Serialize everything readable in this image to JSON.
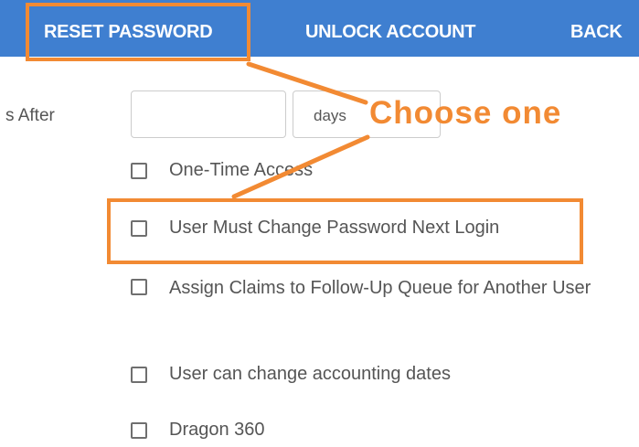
{
  "toolbar": {
    "reset_password": "RESET PASSWORD",
    "unlock_account": "UNLOCK ACCOUNT",
    "back": "BACK"
  },
  "expiry": {
    "label": "s After",
    "number_value": "",
    "unit_selected": "days"
  },
  "options": [
    {
      "label": "One-Time Access",
      "checked": false
    },
    {
      "label": "User Must Change Password Next Login",
      "checked": false
    },
    {
      "label": "Assign Claims to Follow-Up Queue for Another User",
      "checked": false
    },
    {
      "label": "User can change accounting dates",
      "checked": false
    },
    {
      "label": "Dragon 360",
      "checked": false
    }
  ],
  "annotation": {
    "text": "Choose one",
    "color": "#f28a33"
  },
  "colors": {
    "toolbar": "#3f7fd0",
    "annotation": "#f28a33"
  }
}
